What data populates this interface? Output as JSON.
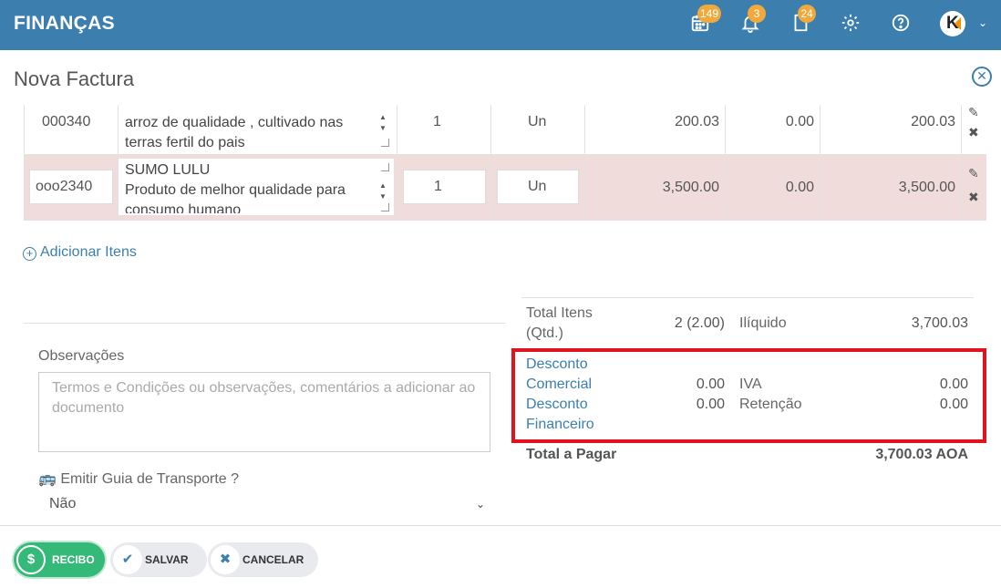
{
  "app": {
    "title": "FINANÇAS"
  },
  "topbar": {
    "calendar_badge": "149",
    "bell_badge": "3",
    "doc_badge": "24",
    "avatar_letter": "K",
    "colors": {
      "bar": "#3c7fae",
      "badge": "#f0a93a"
    }
  },
  "page": {
    "title": "Nova Factura"
  },
  "items": [
    {
      "code": "000340",
      "description": "arroz de qualidade , cultivado nas terras fertil do pais",
      "qty": "1",
      "unit": "Un",
      "price": "200.03",
      "discount": "0.00",
      "total": "200.03"
    },
    {
      "code": "ooo2340",
      "description": "SUMO LULU\nProduto de melhor qualidade para consumo humano",
      "qty": "1",
      "unit": "Un",
      "price": "3,500.00",
      "discount": "0.00",
      "total": "3,500.00"
    }
  ],
  "add_items_label": "Adicionar Itens",
  "observations": {
    "label": "Observações",
    "placeholder": "Termos e Condições ou observações, comentários a adicionar ao documento"
  },
  "transport": {
    "label": "Emitir Guia de Transporte ?",
    "selected": "Não"
  },
  "totals": {
    "total_items_label": "Total Itens (Qtd.)",
    "total_items_value": "2 (2.00)",
    "iliquido_label": "Ilíquido",
    "iliquido_value": "3,700.03",
    "desconto_comercial_label": "Desconto Comercial",
    "desconto_comercial_value": "0.00",
    "desconto_financeiro_label": "Desconto Financeiro",
    "desconto_financeiro_value": "0.00",
    "iva_label": "IVA",
    "iva_value": "0.00",
    "retencao_label": "Retenção",
    "retencao_value": "0.00",
    "grand_total_label": "Total a Pagar",
    "grand_total_value": "3,700.03 AOA"
  },
  "footer": {
    "recibo": "RECIBO",
    "salvar": "SALVAR",
    "cancelar": "CANCELAR"
  }
}
